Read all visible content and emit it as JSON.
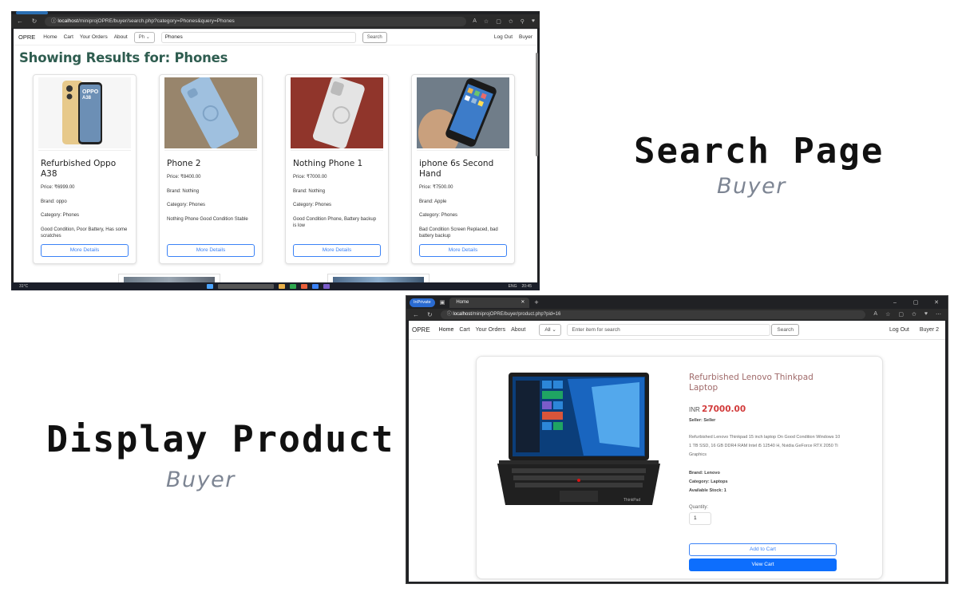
{
  "search_shot": {
    "url_host": "localhost",
    "url_path": "/miniprojOPRE/buyer/search.php?category=Phones&query=Phones",
    "nav": {
      "brand": "OPRE",
      "links": [
        "Home",
        "Cart",
        "Your Orders",
        "About"
      ],
      "category_select": "Ph",
      "search_value": "Phones",
      "search_button": "Search",
      "logout": "Log Out",
      "user": "Buyer"
    },
    "heading": "Showing Results for: Phones",
    "products": [
      {
        "title": "Refurbished Oppo A38",
        "price": "Price: ₹6999.00",
        "brand": "Brand: oppo",
        "category": "Category: Phones",
        "description": "Good Condition, Poor Battery, Has some scratches",
        "button": "More Details"
      },
      {
        "title": "Phone 2",
        "price": "Price: ₹8400.00",
        "brand": "Brand: Nothing",
        "category": "Category: Phones",
        "description": "Nothing Phone Good Condition Stable",
        "button": "More Details"
      },
      {
        "title": "Nothing Phone 1",
        "price": "Price: ₹7000.00",
        "brand": "Brand: Nothing",
        "category": "Category: Phones",
        "description": "Good Condition Phone, Battery backup is low",
        "button": "More Details"
      },
      {
        "title": "iphone 6s Second Hand",
        "price": "Price: ₹7500.00",
        "brand": "Brand: Apple",
        "category": "Category: Phones",
        "description": "Bad Condition Screen Replaced, bad battery backup",
        "button": "More Details"
      }
    ],
    "taskbar": {
      "weather": "31°C",
      "lang": "ENG",
      "time": "20:45"
    }
  },
  "captions": {
    "search_title": "Search Page",
    "search_sub": "Buyer",
    "display_title": "Display Product",
    "display_sub": "Buyer"
  },
  "product_shot": {
    "inprivate": "InPrivate",
    "tab_title": "Home",
    "url_host": "localhost",
    "url_path": "/miniprojOPRE/buyer/product.php?pid=16",
    "nav": {
      "brand": "OPRE",
      "links": [
        "Home",
        "Cart",
        "Your Orders",
        "About"
      ],
      "category_select": "All",
      "search_placeholder": "Enter item for search",
      "search_button": "Search",
      "logout": "Log Out",
      "user": "Buyer 2"
    },
    "product": {
      "title": "Refurbished Lenovo Thinkpad Laptop",
      "currency": "INR",
      "amount": "27000.00",
      "seller": "Seller: Seller",
      "description": "Refurbished Lenovo Thinkpad 15 inch laptop On Good Condition Windows 10 1 TB SSD, 16 GB DDR4 RAM Intel i5 12540 H, Nvidia GeForce RTX 2050 Ti Graphics",
      "brand": "Brand: Lenovo",
      "category": "Category: Laptops",
      "stock": "Available Stock: 1",
      "quantity_label": "Quantity:",
      "quantity_value": "1",
      "add_to_cart": "Add to Cart",
      "view_cart": "View Cart"
    }
  }
}
